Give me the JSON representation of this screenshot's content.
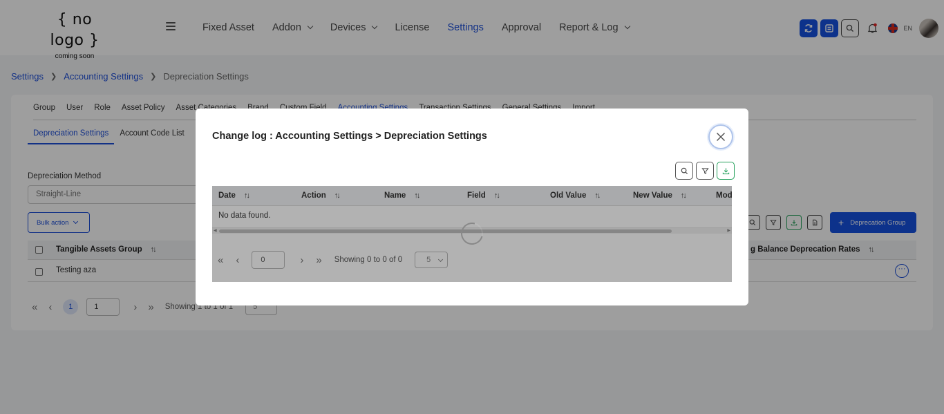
{
  "header": {
    "logo_main": "{ no logo }",
    "logo_sub": "coming soon",
    "nav": [
      {
        "label": "Fixed Asset",
        "dropdown": false,
        "active": false
      },
      {
        "label": "Addon",
        "dropdown": true,
        "active": false
      },
      {
        "label": "Devices",
        "dropdown": true,
        "active": false
      },
      {
        "label": "License",
        "dropdown": false,
        "active": false
      },
      {
        "label": "Settings",
        "dropdown": false,
        "active": true
      },
      {
        "label": "Approval",
        "dropdown": false,
        "active": false
      },
      {
        "label": "Report & Log",
        "dropdown": true,
        "active": false
      }
    ],
    "lang": "EN",
    "icons": [
      "sync-icon",
      "list-icon",
      "search-icon",
      "bell-icon",
      "uk-flag-icon"
    ]
  },
  "breadcrumb": {
    "items": [
      "Settings",
      "Accounting Settings"
    ],
    "current": "Depreciation Settings"
  },
  "tabs": [
    "Group",
    "User",
    "Role",
    "Asset Policy",
    "Asset Categories",
    "Brand",
    "Custom Field",
    "Accounting Settings",
    "Transaction Settings",
    "General Settings",
    "Import"
  ],
  "subtabs": [
    "Depreciation Settings",
    "Account Code List"
  ],
  "form": {
    "method_label": "Depreciation Method",
    "method_value": "Straight-Line"
  },
  "actions": {
    "bulk": "Bulk action",
    "add_group": "Deprecation Group"
  },
  "table": {
    "col1": "Tangible Assets Group",
    "col2": "g Balance Deprecation Rates",
    "rows": [
      {
        "name": "Testing aza"
      }
    ]
  },
  "pagination": {
    "current": "1",
    "input": "1",
    "showing": "Showing 1 to 1 of 1",
    "size": "5"
  },
  "modal": {
    "title": "Change log : Accounting Settings > Depreciation Settings",
    "columns": [
      "Date",
      "Action",
      "Name",
      "Field",
      "Old Value",
      "New Value",
      "Mod"
    ],
    "empty": "No data found.",
    "page_input": "0",
    "showing": "Showing 0 to 0 of 0",
    "size": "5"
  },
  "colors": {
    "accent": "#1e4fd8",
    "primary_button": "#1652e0",
    "export_green": "#22a05a"
  }
}
